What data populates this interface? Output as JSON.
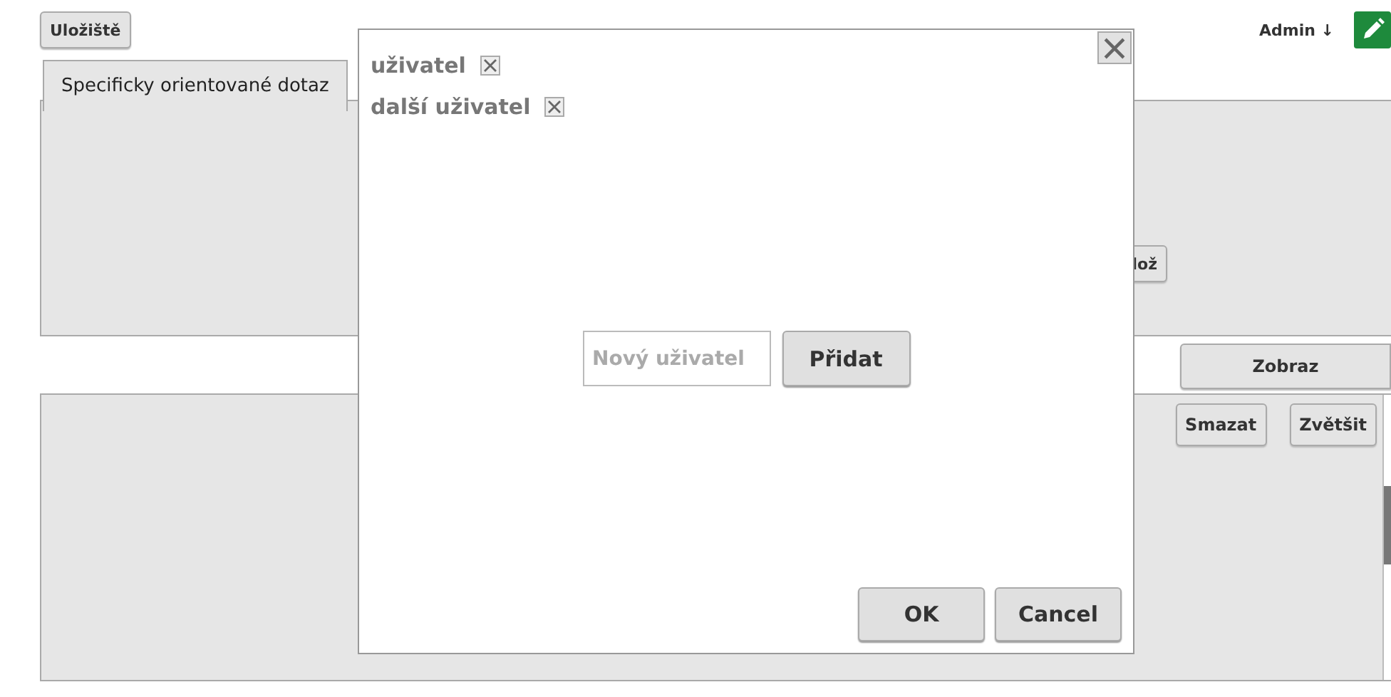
{
  "header": {
    "storage_button": "Uložiště",
    "user_menu": "Admin ↓"
  },
  "tabs": [
    {
      "label": "Specificky orientované dotaz",
      "selected": true
    }
  ],
  "top_panel": {
    "button": "lož"
  },
  "show_button": "Zobraz",
  "bottom_panel": {
    "buttons": [
      "Smazat",
      "Zvětšit"
    ]
  },
  "dialog": {
    "users": [
      {
        "name": "uživatel"
      },
      {
        "name": "další uživatel"
      }
    ],
    "new_user": {
      "placeholder": "Nový uživatel"
    },
    "add_button": "Přidat",
    "buttons": [
      "OK",
      "Cancel"
    ]
  }
}
